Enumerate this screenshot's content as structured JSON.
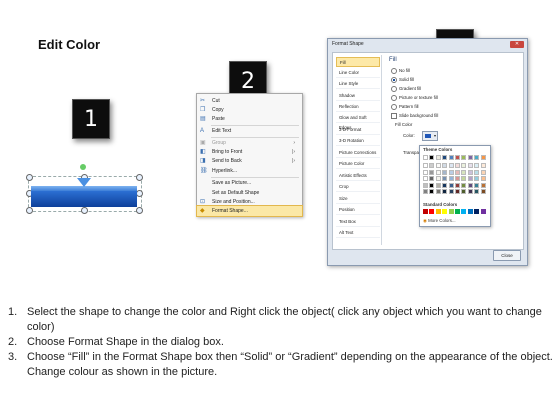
{
  "slide": {
    "title": "Edit Color"
  },
  "steps": {
    "step1": "1",
    "step2": "2",
    "step3": "3"
  },
  "context_menu": {
    "items": [
      {
        "label": "Cut",
        "icon": "scissors-icon",
        "disabled": false
      },
      {
        "label": "Copy",
        "icon": "copy-icon",
        "disabled": false
      },
      {
        "label": "Paste",
        "icon": "paste-icon",
        "disabled": false
      },
      {
        "label": "Edit Text",
        "icon": "edit-text-icon",
        "disabled": false
      },
      {
        "label": "Group",
        "icon": "group-icon",
        "disabled": true,
        "submenu": true
      },
      {
        "label": "Bring to Front",
        "icon": "bring-front-icon",
        "disabled": false,
        "submenu": true
      },
      {
        "label": "Send to Back",
        "icon": "send-back-icon",
        "disabled": false,
        "submenu": true
      },
      {
        "label": "Hyperlink...",
        "icon": "hyperlink-icon",
        "disabled": false
      },
      {
        "label": "Save as Picture...",
        "icon": "",
        "disabled": false
      },
      {
        "label": "Set as Default Shape",
        "icon": "",
        "disabled": false
      },
      {
        "label": "Size and Position...",
        "icon": "size-position-icon",
        "disabled": false
      },
      {
        "label": "Format Shape...",
        "icon": "format-shape-icon",
        "disabled": false,
        "highlighted": true
      }
    ]
  },
  "dialog": {
    "title": "Format Shape",
    "categories": [
      "Fill",
      "Line Color",
      "Line Style",
      "Shadow",
      "Reflection",
      "Glow and Soft Edges",
      "3-D Format",
      "3-D Rotation",
      "Picture Corrections",
      "Picture Color",
      "Artistic Effects",
      "Crop",
      "Size",
      "Position",
      "Text Box",
      "Alt Text"
    ],
    "selected_category": "Fill",
    "fill_heading": "Fill",
    "options": [
      "No fill",
      "Solid fill",
      "Gradient fill",
      "Picture or texture fill",
      "Pattern fill"
    ],
    "selected_option": "Solid fill",
    "slide_background": "Slide background fill",
    "fill_color_label": "Fill Color",
    "color_label": "Color:",
    "transparency_label": "Transpar",
    "theme_colors_label": "Theme Colors",
    "standard_colors_label": "Standard Colors",
    "more_colors_label": "More Colors...",
    "close_label": "Close",
    "theme_top_row": [
      "#ffffff",
      "#000000",
      "#eeece1",
      "#1f497d",
      "#4f81bd",
      "#c0504d",
      "#9bbb59",
      "#8064a2",
      "#4bacc6",
      "#f79646"
    ],
    "standard_row": [
      "#c00000",
      "#ff0000",
      "#ffc000",
      "#ffff00",
      "#92d050",
      "#00b050",
      "#00b0f0",
      "#0070c0",
      "#002060",
      "#7030a0"
    ]
  },
  "instructions": [
    {
      "num": "1.",
      "text": "Select the shape to change the color and Right click the object( click any object which you want to change color)"
    },
    {
      "num": "2.",
      "text": "Choose Format Shape in the dialog box."
    },
    {
      "num": "3.",
      "text": "Choose “Fill” in the Format Shape box then “Solid” or “Gradient” depending on the appearance of the object. Change colour as shown in the picture."
    }
  ]
}
